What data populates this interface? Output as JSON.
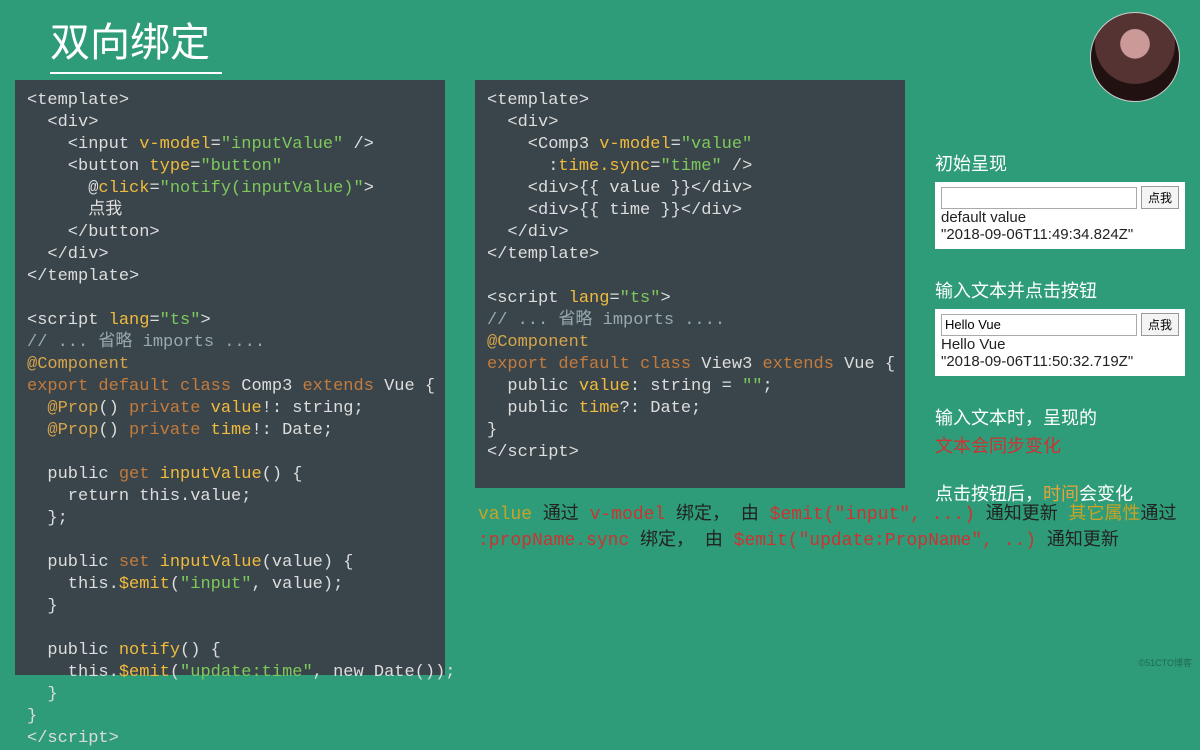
{
  "title": "双向绑定",
  "code_left": {
    "l1": "<template>",
    "l2": "  <div>",
    "l3a": "    <input ",
    "l3b": "v-model",
    "l3c": "=",
    "l3d": "\"inputValue\"",
    "l3e": " />",
    "l4a": "    <button ",
    "l4b": "type",
    "l4c": "=",
    "l4d": "\"button\"",
    "l5a": "      @",
    "l5b": "click",
    "l5c": "=",
    "l5d": "\"notify(inputValue)\"",
    "l5e": ">",
    "l6": "      点我",
    "l7": "    </button>",
    "l8": "  </div>",
    "l9": "</template>",
    "l10": "",
    "l11a": "<script ",
    "l11b": "lang",
    "l11c": "=",
    "l11d": "\"ts\"",
    "l11e": ">",
    "l12": "// ... 省略 imports ....",
    "l13a": "@",
    "l13b": "Component",
    "l14a": "export ",
    "l14b": "default ",
    "l14c": "class ",
    "l14d": "Comp3 ",
    "l14e": "extends ",
    "l14f": "Vue {",
    "l15a": "  @",
    "l15b": "Prop",
    "l15c": "() ",
    "l15d": "private ",
    "l15e": "value",
    "l15f": "!: string;",
    "l16a": "  @",
    "l16b": "Prop",
    "l16c": "() ",
    "l16d": "private ",
    "l16e": "time",
    "l16f": "!: Date;",
    "l17": "",
    "l18a": "  public ",
    "l18b": "get ",
    "l18c": "inputValue",
    "l18d": "() {",
    "l19": "    return this.value;",
    "l20": "  };",
    "l21": "",
    "l22a": "  public ",
    "l22b": "set ",
    "l22c": "inputValue",
    "l22d": "(value) {",
    "l23a": "    this.",
    "l23b": "$emit",
    "l23c": "(",
    "l23d": "\"input\"",
    "l23e": ", value);",
    "l24": "  }",
    "l25": "",
    "l26a": "  public ",
    "l26b": "notify",
    "l26c": "() {",
    "l27a": "    this.",
    "l27b": "$emit",
    "l27c": "(",
    "l27d": "\"update:time\"",
    "l27e": ", new Date());",
    "l28": "  }",
    "l29": "}",
    "l30": "</scr",
    "l30b": "ipt>"
  },
  "code_mid": {
    "l1": "<template>",
    "l2": "  <div>",
    "l3a": "    <Comp3 ",
    "l3b": "v-model",
    "l3c": "=",
    "l3d": "\"value\"",
    "l4a": "      :",
    "l4b": "time.sync",
    "l4c": "=",
    "l4d": "\"time\"",
    "l4e": " />",
    "l5": "    <div>{{ value }}</div>",
    "l6": "    <div>{{ time }}</div>",
    "l7": "  </div>",
    "l8": "</template>",
    "l9": "",
    "l10a": "<script ",
    "l10b": "lang",
    "l10c": "=",
    "l10d": "\"ts\"",
    "l10e": ">",
    "l11": "// ... 省略 imports ....",
    "l12a": "@",
    "l12b": "Component",
    "l13a": "export ",
    "l13b": "default ",
    "l13c": "class ",
    "l13d": "View3 ",
    "l13e": "extends ",
    "l13f": "Vue {",
    "l14a": "  public ",
    "l14b": "value",
    "l14c": ": string = ",
    "l14d": "\"\"",
    "l14e": ";",
    "l15a": "  public ",
    "l15b": "time",
    "l15c": "?: Date;",
    "l16": "}",
    "l17": "</scr",
    "l17b": "ipt>"
  },
  "notes": {
    "n1a": "value ",
    "n1b": "通过 ",
    "n1c": "v-model ",
    "n1d": "绑定，",
    "n2a": "       由 ",
    "n2b": "$emit(",
    "n2c": "\"input\", ...) ",
    "n2d": "通知更新",
    "n3": "",
    "n4a": "其它属性",
    "n4b": "通过 ",
    "n4c": ":propName.sync ",
    "n4d": "绑定，",
    "n5a": "       由 ",
    "n5b": "$emit(",
    "n5c": "\"update:PropName\", ..)",
    "n5d": "       通知更新"
  },
  "sidebar": {
    "h1": "初始呈现",
    "preview1": {
      "input": "",
      "button": "点我",
      "line1": "default value",
      "line2": "\"2018-09-06T11:49:34.824Z\""
    },
    "h2": "输入文本并点击按钮",
    "preview2": {
      "input": "Hello Vue",
      "button": "点我",
      "line1": "Hello Vue",
      "line2": "\"2018-09-06T11:50:32.719Z\""
    },
    "t1a": "输入文本时，呈现的",
    "t1b": "文本会同步变化",
    "t2a": "点击按钮后，",
    "t2b": "时间",
    "t2c": "会变化"
  },
  "watermark": "©51CTO博客"
}
